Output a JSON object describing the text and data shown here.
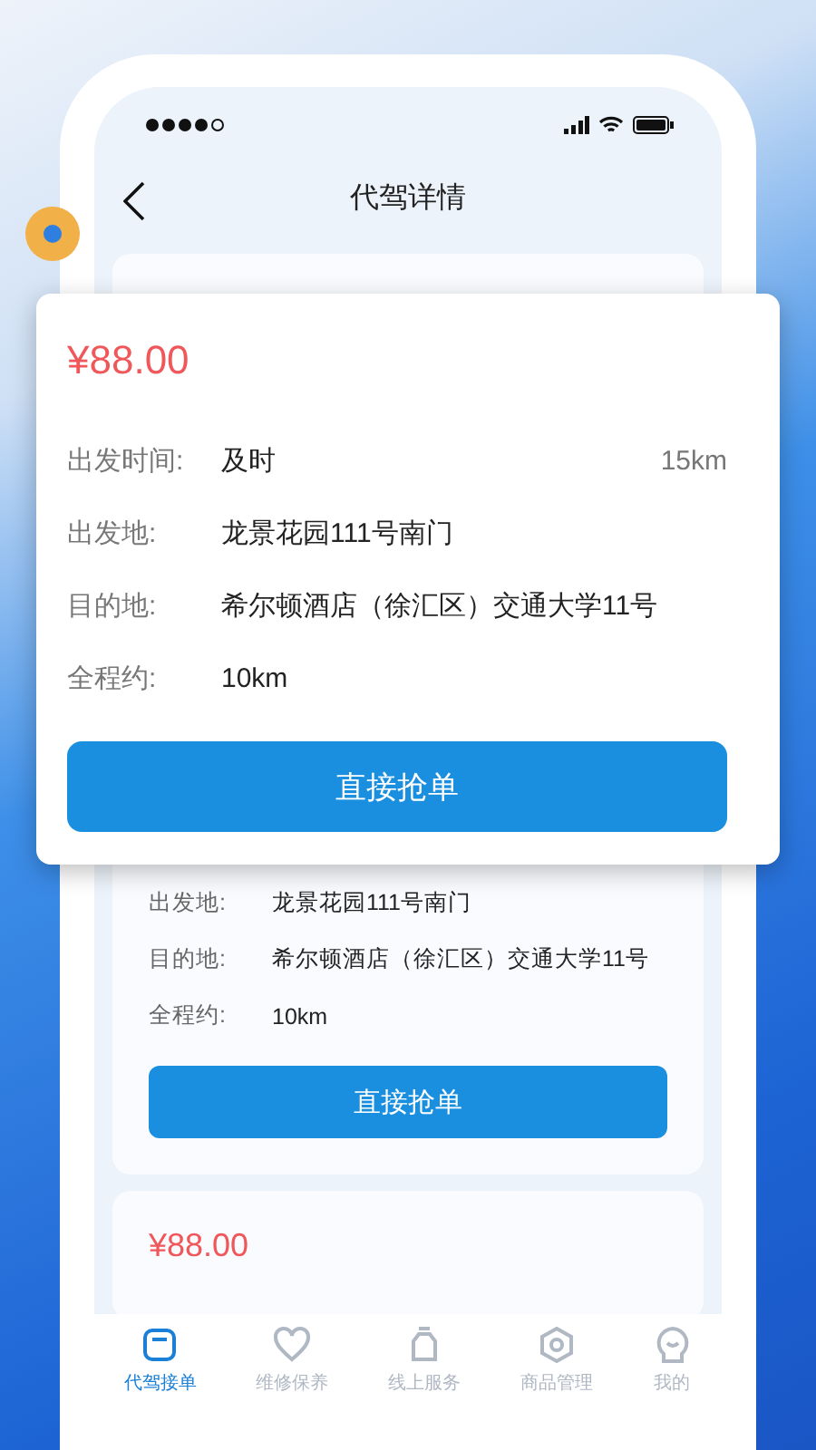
{
  "header": {
    "title": "代驾详情"
  },
  "popup": {
    "price": "¥88.00",
    "rows": [
      {
        "label": "出发时间:",
        "value": "及时",
        "distance": "15km"
      },
      {
        "label": "出发地:",
        "value": "龙景花园111号南门"
      },
      {
        "label": "目的地:",
        "value": "希尔顿酒店（徐汇区）交通大学11号"
      },
      {
        "label": "全程约:",
        "value": "10km"
      }
    ],
    "button": "直接抢单"
  },
  "orders": [
    {
      "rows": [
        {
          "label": "出发地:",
          "value": "龙景花园111号南门"
        },
        {
          "label": "目的地:",
          "value": "希尔顿酒店（徐汇区）交通大学11号"
        },
        {
          "label": "全程约:",
          "value": "10km"
        }
      ],
      "button": "直接抢单"
    },
    {
      "price": "¥88.00"
    }
  ],
  "tabs": [
    {
      "label": "代驾接单",
      "selected": true
    },
    {
      "label": "维修保养",
      "selected": false
    },
    {
      "label": "线上服务",
      "selected": false
    },
    {
      "label": "商品管理",
      "selected": false
    },
    {
      "label": "我的",
      "selected": false
    }
  ]
}
